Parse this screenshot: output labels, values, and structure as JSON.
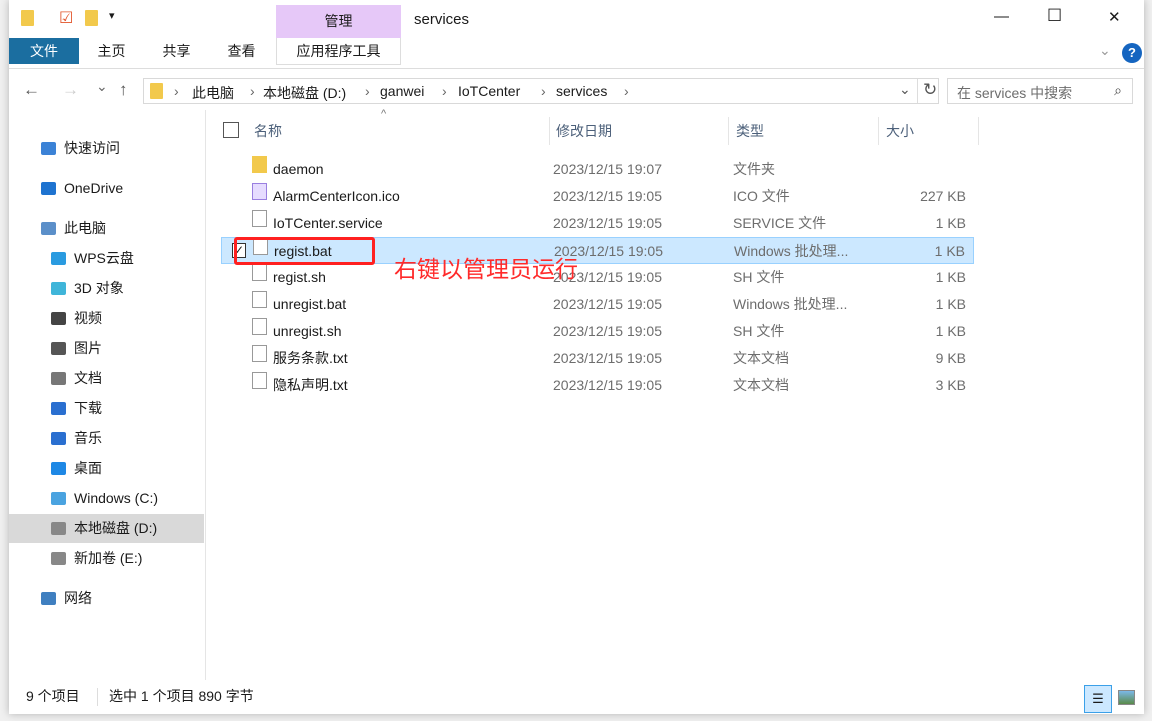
{
  "window": {
    "title": "services",
    "min": "—",
    "max": "☐",
    "close": "✕"
  },
  "ribbon": {
    "context_group": "管理",
    "context_tab": "应用程序工具",
    "tabs": [
      "文件",
      "主页",
      "共享",
      "查看"
    ],
    "help": "?"
  },
  "nav": {
    "back": "←",
    "forward": "→",
    "recent": "⌄",
    "up": "↑",
    "refresh": "↻",
    "breadcrumb": [
      "此电脑",
      "本地磁盘 (D:)",
      "ganwei",
      "IoTCenter",
      "services"
    ]
  },
  "search": {
    "placeholder": "在 services 中搜索"
  },
  "sidebar": {
    "items": [
      "快速访问",
      "OneDrive",
      "此电脑",
      "WPS云盘",
      "3D 对象",
      "视频",
      "图片",
      "文档",
      "下载",
      "音乐",
      "桌面",
      "Windows (C:)",
      "本地磁盘 (D:)",
      "新加卷 (E:)",
      "网络"
    ]
  },
  "columns": {
    "name": "名称",
    "date": "修改日期",
    "type": "类型",
    "size": "大小"
  },
  "files": [
    {
      "name": "daemon",
      "date": "2023/12/15 19:07",
      "type": "文件夹",
      "size": ""
    },
    {
      "name": "AlarmCenterIcon.ico",
      "date": "2023/12/15 19:05",
      "type": "ICO 文件",
      "size": "227 KB"
    },
    {
      "name": "IoTCenter.service",
      "date": "2023/12/15 19:05",
      "type": "SERVICE 文件",
      "size": "1 KB"
    },
    {
      "name": "regist.bat",
      "date": "2023/12/15 19:05",
      "type": "Windows 批处理...",
      "size": "1 KB"
    },
    {
      "name": "regist.sh",
      "date": "2023/12/15 19:05",
      "type": "SH 文件",
      "size": "1 KB"
    },
    {
      "name": "unregist.bat",
      "date": "2023/12/15 19:05",
      "type": "Windows 批处理...",
      "size": "1 KB"
    },
    {
      "name": "unregist.sh",
      "date": "2023/12/15 19:05",
      "type": "SH 文件",
      "size": "1 KB"
    },
    {
      "name": "服务条款.txt",
      "date": "2023/12/15 19:05",
      "type": "文本文档",
      "size": "9 KB"
    },
    {
      "name": "隐私声明.txt",
      "date": "2023/12/15 19:05",
      "type": "文本文档",
      "size": "3 KB"
    }
  ],
  "status": {
    "count": "9 个项目",
    "selected": "选中 1 个项目  890 字节"
  },
  "annotation": "右键以管理员运行"
}
